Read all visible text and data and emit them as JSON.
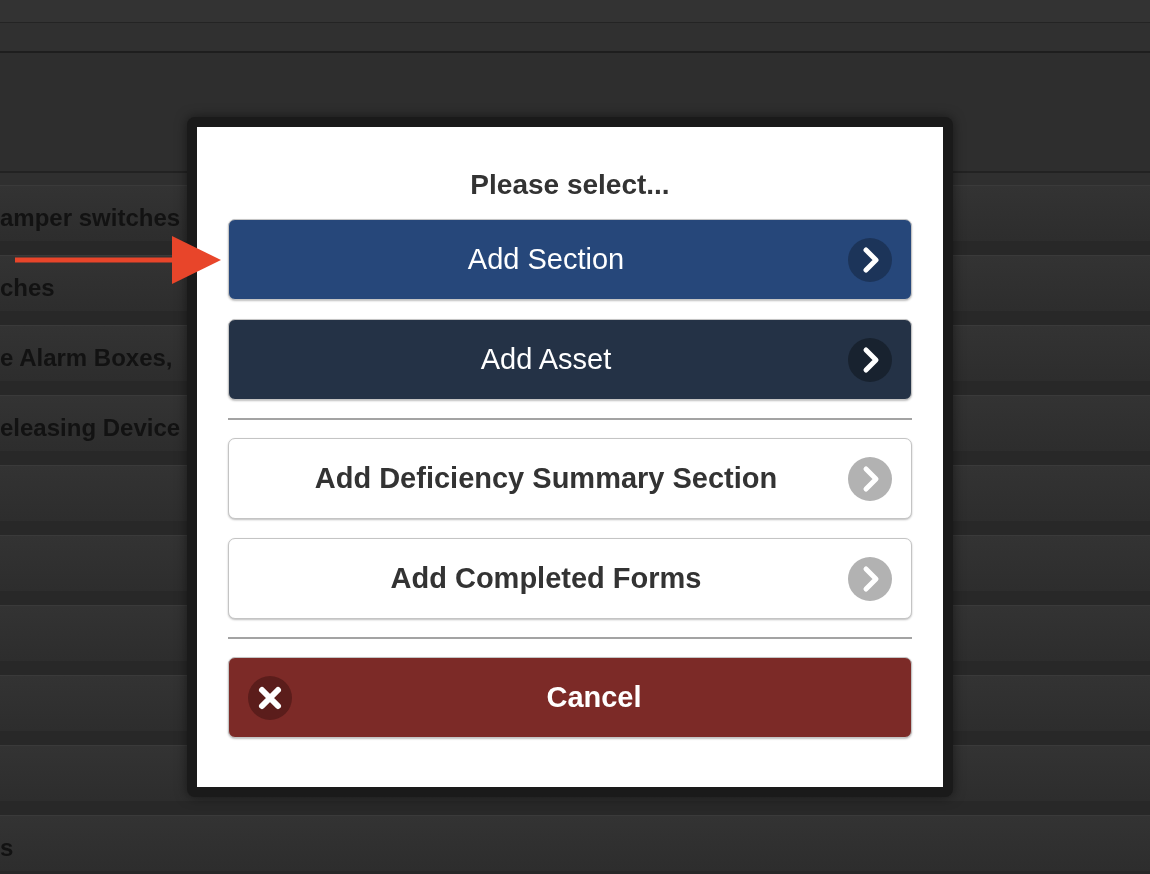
{
  "background_list": {
    "rows": [
      {
        "label": "amper switches"
      },
      {
        "label": "ches"
      },
      {
        "label": "e Alarm Boxes,"
      },
      {
        "label": "eleasing Device"
      },
      {},
      {},
      {},
      {},
      {},
      {
        "label": "s"
      }
    ]
  },
  "dialog": {
    "title": "Please select...",
    "option_groups": [
      [
        {
          "label": "Add Section",
          "kind": "primary"
        },
        {
          "label": "Add Asset",
          "kind": "dark"
        }
      ],
      [
        {
          "label": "Add Deficiency Summary Section",
          "kind": "light"
        },
        {
          "label": "Add Completed Forms",
          "kind": "light"
        }
      ]
    ],
    "cancel": {
      "label": "Cancel"
    }
  }
}
